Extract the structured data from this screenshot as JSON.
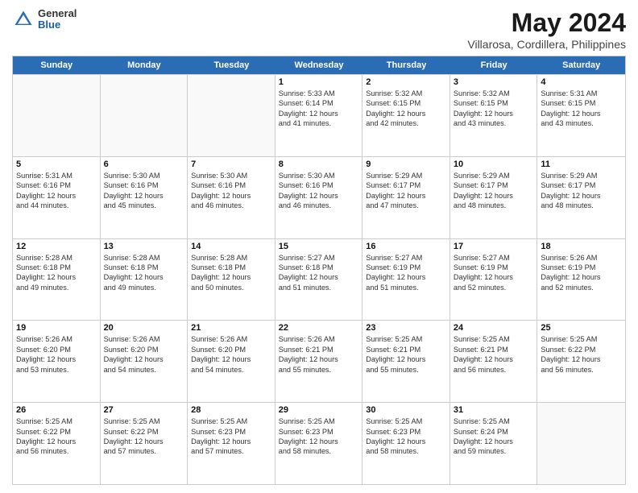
{
  "logo": {
    "general": "General",
    "blue": "Blue"
  },
  "title": "May 2024",
  "subtitle": "Villarosa, Cordillera, Philippines",
  "weekdays": [
    "Sunday",
    "Monday",
    "Tuesday",
    "Wednesday",
    "Thursday",
    "Friday",
    "Saturday"
  ],
  "rows": [
    [
      {
        "day": "",
        "text": "",
        "empty": true
      },
      {
        "day": "",
        "text": "",
        "empty": true
      },
      {
        "day": "",
        "text": "",
        "empty": true
      },
      {
        "day": "1",
        "text": "Sunrise: 5:33 AM\nSunset: 6:14 PM\nDaylight: 12 hours\nand 41 minutes."
      },
      {
        "day": "2",
        "text": "Sunrise: 5:32 AM\nSunset: 6:15 PM\nDaylight: 12 hours\nand 42 minutes."
      },
      {
        "day": "3",
        "text": "Sunrise: 5:32 AM\nSunset: 6:15 PM\nDaylight: 12 hours\nand 43 minutes."
      },
      {
        "day": "4",
        "text": "Sunrise: 5:31 AM\nSunset: 6:15 PM\nDaylight: 12 hours\nand 43 minutes."
      }
    ],
    [
      {
        "day": "5",
        "text": "Sunrise: 5:31 AM\nSunset: 6:16 PM\nDaylight: 12 hours\nand 44 minutes."
      },
      {
        "day": "6",
        "text": "Sunrise: 5:30 AM\nSunset: 6:16 PM\nDaylight: 12 hours\nand 45 minutes."
      },
      {
        "day": "7",
        "text": "Sunrise: 5:30 AM\nSunset: 6:16 PM\nDaylight: 12 hours\nand 46 minutes."
      },
      {
        "day": "8",
        "text": "Sunrise: 5:30 AM\nSunset: 6:16 PM\nDaylight: 12 hours\nand 46 minutes."
      },
      {
        "day": "9",
        "text": "Sunrise: 5:29 AM\nSunset: 6:17 PM\nDaylight: 12 hours\nand 47 minutes."
      },
      {
        "day": "10",
        "text": "Sunrise: 5:29 AM\nSunset: 6:17 PM\nDaylight: 12 hours\nand 48 minutes."
      },
      {
        "day": "11",
        "text": "Sunrise: 5:29 AM\nSunset: 6:17 PM\nDaylight: 12 hours\nand 48 minutes."
      }
    ],
    [
      {
        "day": "12",
        "text": "Sunrise: 5:28 AM\nSunset: 6:18 PM\nDaylight: 12 hours\nand 49 minutes."
      },
      {
        "day": "13",
        "text": "Sunrise: 5:28 AM\nSunset: 6:18 PM\nDaylight: 12 hours\nand 49 minutes."
      },
      {
        "day": "14",
        "text": "Sunrise: 5:28 AM\nSunset: 6:18 PM\nDaylight: 12 hours\nand 50 minutes."
      },
      {
        "day": "15",
        "text": "Sunrise: 5:27 AM\nSunset: 6:18 PM\nDaylight: 12 hours\nand 51 minutes."
      },
      {
        "day": "16",
        "text": "Sunrise: 5:27 AM\nSunset: 6:19 PM\nDaylight: 12 hours\nand 51 minutes."
      },
      {
        "day": "17",
        "text": "Sunrise: 5:27 AM\nSunset: 6:19 PM\nDaylight: 12 hours\nand 52 minutes."
      },
      {
        "day": "18",
        "text": "Sunrise: 5:26 AM\nSunset: 6:19 PM\nDaylight: 12 hours\nand 52 minutes."
      }
    ],
    [
      {
        "day": "19",
        "text": "Sunrise: 5:26 AM\nSunset: 6:20 PM\nDaylight: 12 hours\nand 53 minutes."
      },
      {
        "day": "20",
        "text": "Sunrise: 5:26 AM\nSunset: 6:20 PM\nDaylight: 12 hours\nand 54 minutes."
      },
      {
        "day": "21",
        "text": "Sunrise: 5:26 AM\nSunset: 6:20 PM\nDaylight: 12 hours\nand 54 minutes."
      },
      {
        "day": "22",
        "text": "Sunrise: 5:26 AM\nSunset: 6:21 PM\nDaylight: 12 hours\nand 55 minutes."
      },
      {
        "day": "23",
        "text": "Sunrise: 5:25 AM\nSunset: 6:21 PM\nDaylight: 12 hours\nand 55 minutes."
      },
      {
        "day": "24",
        "text": "Sunrise: 5:25 AM\nSunset: 6:21 PM\nDaylight: 12 hours\nand 56 minutes."
      },
      {
        "day": "25",
        "text": "Sunrise: 5:25 AM\nSunset: 6:22 PM\nDaylight: 12 hours\nand 56 minutes."
      }
    ],
    [
      {
        "day": "26",
        "text": "Sunrise: 5:25 AM\nSunset: 6:22 PM\nDaylight: 12 hours\nand 56 minutes."
      },
      {
        "day": "27",
        "text": "Sunrise: 5:25 AM\nSunset: 6:22 PM\nDaylight: 12 hours\nand 57 minutes."
      },
      {
        "day": "28",
        "text": "Sunrise: 5:25 AM\nSunset: 6:23 PM\nDaylight: 12 hours\nand 57 minutes."
      },
      {
        "day": "29",
        "text": "Sunrise: 5:25 AM\nSunset: 6:23 PM\nDaylight: 12 hours\nand 58 minutes."
      },
      {
        "day": "30",
        "text": "Sunrise: 5:25 AM\nSunset: 6:23 PM\nDaylight: 12 hours\nand 58 minutes."
      },
      {
        "day": "31",
        "text": "Sunrise: 5:25 AM\nSunset: 6:24 PM\nDaylight: 12 hours\nand 59 minutes."
      },
      {
        "day": "",
        "text": "",
        "empty": true
      }
    ]
  ]
}
